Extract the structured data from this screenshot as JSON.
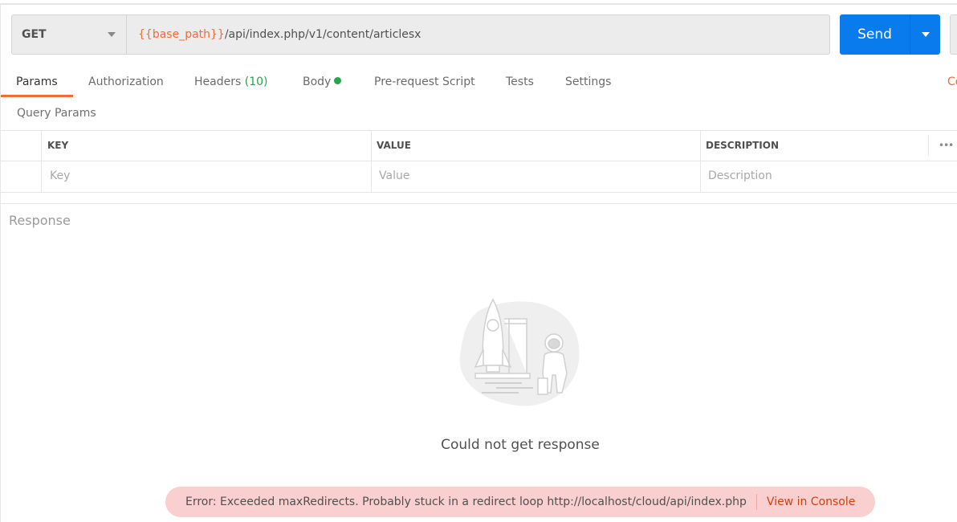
{
  "request": {
    "method": "GET",
    "url_variable": "{{base_path}}",
    "url_path": "/api/index.php/v1/content/articlesx",
    "send_label": "Send"
  },
  "tabs": [
    {
      "label": "Params",
      "active": true
    },
    {
      "label": "Authorization"
    },
    {
      "label": "Headers",
      "count": "(10)"
    },
    {
      "label": "Body",
      "has_indicator": true
    },
    {
      "label": "Pre-request Script"
    },
    {
      "label": "Tests"
    },
    {
      "label": "Settings"
    }
  ],
  "cookies_link": "Cookies",
  "query_params": {
    "title": "Query Params",
    "columns": [
      "KEY",
      "VALUE",
      "DESCRIPTION"
    ],
    "placeholders": {
      "key": "Key",
      "value": "Value",
      "description": "Description"
    },
    "more_label": "•••"
  },
  "response": {
    "title": "Response",
    "empty_message": "Could not get response",
    "error_message": "Error: Exceeded maxRedirects. Probably stuck in a redirect loop http://localhost/cloud/api/index.php",
    "view_console": "View in Console"
  },
  "colors": {
    "accent": "#f26b3a",
    "send": "#097bed",
    "success": "#26a54a",
    "error_bg": "#f9d0cf",
    "error_link": "#d23f0f"
  }
}
